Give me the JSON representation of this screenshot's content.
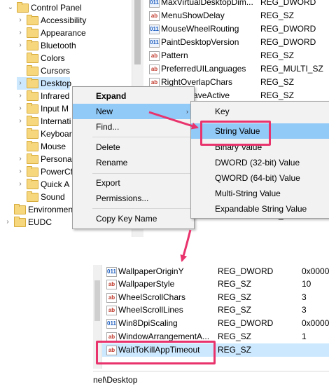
{
  "tree": {
    "items": [
      {
        "label": "Control Panel",
        "chevron": "⌄",
        "selected": false
      },
      {
        "label": "Accessibility",
        "chevron": "›",
        "selected": false
      },
      {
        "label": "Appearance",
        "chevron": "›",
        "selected": false
      },
      {
        "label": "Bluetooth",
        "chevron": "›",
        "selected": false
      },
      {
        "label": "Colors",
        "chevron": "",
        "selected": false
      },
      {
        "label": "Cursors",
        "chevron": "",
        "selected": false
      },
      {
        "label": "Desktop",
        "chevron": "›",
        "selected": true
      },
      {
        "label": "Infrared",
        "chevron": "›",
        "selected": false
      },
      {
        "label": "Input M",
        "chevron": "›",
        "selected": false
      },
      {
        "label": "Internati",
        "chevron": "›",
        "selected": false
      },
      {
        "label": "Keyboar",
        "chevron": "",
        "selected": false
      },
      {
        "label": "Mouse",
        "chevron": "",
        "selected": false
      },
      {
        "label": "Persona",
        "chevron": "›",
        "selected": false
      },
      {
        "label": "PowerCf",
        "chevron": "›",
        "selected": false
      },
      {
        "label": "Quick A",
        "chevron": "›",
        "selected": false
      },
      {
        "label": "Sound",
        "chevron": "",
        "selected": false
      },
      {
        "label": "Environmen",
        "chevron": "",
        "selected": false
      },
      {
        "label": "EUDC",
        "chevron": "›",
        "selected": false
      }
    ]
  },
  "values_top": [
    {
      "name": "MaxVirtualDesktopDim...",
      "type": "REG_DWORD",
      "icon": "dw"
    },
    {
      "name": "MenuShowDelay",
      "type": "REG_SZ",
      "icon": "sz"
    },
    {
      "name": "MouseWheelRouting",
      "type": "REG_DWORD",
      "icon": "dw"
    },
    {
      "name": "PaintDesktopVersion",
      "type": "REG_DWORD",
      "icon": "dw"
    },
    {
      "name": "Pattern",
      "type": "REG_SZ",
      "icon": "sz"
    },
    {
      "name": "PreferredUILanguages",
      "type": "REG_MULTI_SZ",
      "icon": "sz"
    },
    {
      "name": "RightOverlapChars",
      "type": "REG_SZ",
      "icon": "sz"
    },
    {
      "name": "ScreenSaveActive",
      "type": "REG_SZ",
      "icon": "sz"
    },
    {
      "name": "",
      "type": "",
      "icon": ""
    },
    {
      "name": "",
      "type": "",
      "icon": ""
    },
    {
      "name": "",
      "type": "",
      "icon": ""
    },
    {
      "name": "",
      "type": "",
      "icon": ""
    },
    {
      "name": "",
      "type": "",
      "icon": ""
    },
    {
      "name": "",
      "type": "",
      "icon": ""
    },
    {
      "name": "",
      "type": "",
      "icon": ""
    },
    {
      "name": "",
      "type": "",
      "icon": ""
    },
    {
      "name": "WheelScrollChars",
      "type": "REG_SZ",
      "icon": "sz"
    }
  ],
  "context_menu": {
    "expand": "Expand",
    "new": "New",
    "find": "Find...",
    "delete": "Delete",
    "rename": "Rename",
    "export": "Export",
    "permissions": "Permissions...",
    "copy_key_name": "Copy Key Name",
    "submenu_arrow": "›"
  },
  "submenu": {
    "key": "Key",
    "string_value": "String Value",
    "binary_value": "Binary Value",
    "dword_value": "DWORD (32-bit) Value",
    "qword_value": "QWORD (64-bit) Value",
    "multi_string_value": "Multi-String Value",
    "expandable_string_value": "Expandable String Value"
  },
  "values_bottom": [
    {
      "name": "WallpaperOriginY",
      "type": "REG_DWORD",
      "data": "0x0000",
      "icon": "dw"
    },
    {
      "name": "WallpaperStyle",
      "type": "REG_SZ",
      "data": "10",
      "icon": "sz"
    },
    {
      "name": "WheelScrollChars",
      "type": "REG_SZ",
      "data": "3",
      "icon": "sz"
    },
    {
      "name": "WheelScrollLines",
      "type": "REG_SZ",
      "data": "3",
      "icon": "sz"
    },
    {
      "name": "Win8DpiScaling",
      "type": "REG_DWORD",
      "data": "0x0000",
      "icon": "dw"
    },
    {
      "name": "WindowArrangementA...",
      "type": "REG_SZ",
      "data": "1",
      "icon": "sz"
    },
    {
      "name": "WaitToKillAppTimeout",
      "type": "REG_SZ",
      "data": "",
      "icon": "sz"
    }
  ],
  "status_bar": "nel\\Desktop",
  "icon_text": {
    "sz": "ab",
    "dw": "011"
  },
  "colors": {
    "highlight": "#e8336d",
    "selection": "#cce8ff",
    "menu_hover": "#91c9f7"
  }
}
